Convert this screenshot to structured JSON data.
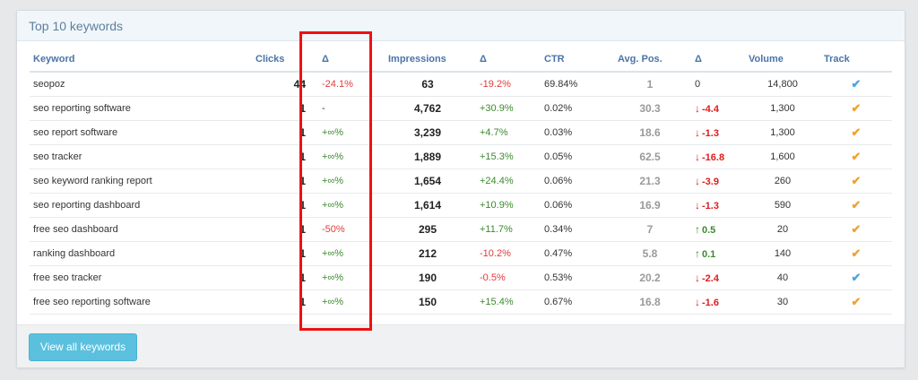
{
  "title": "Top 10 keywords",
  "columns": {
    "keyword": "Keyword",
    "clicks": "Clicks",
    "clicks_delta": "Δ",
    "impressions": "Impressions",
    "impressions_delta": "Δ",
    "ctr": "CTR",
    "avg_pos": "Avg. Pos.",
    "pos_delta": "Δ",
    "volume": "Volume",
    "track": "Track"
  },
  "rows": [
    {
      "keyword": "seopoz",
      "clicks": "44",
      "clicks_delta": "-24.1%",
      "clicks_delta_dir": "down",
      "impressions": "63",
      "impressions_delta": "-19.2%",
      "impressions_delta_dir": "down",
      "ctr": "69.84%",
      "avg_pos": "1",
      "pos_delta": "0",
      "pos_dir": "neutral",
      "pos_arrow": "",
      "volume": "14,800",
      "tracked": "blue"
    },
    {
      "keyword": "seo reporting software",
      "clicks": "1",
      "clicks_delta": "-",
      "clicks_delta_dir": "neutral",
      "impressions": "4,762",
      "impressions_delta": "+30.9%",
      "impressions_delta_dir": "up",
      "ctr": "0.02%",
      "avg_pos": "30.3",
      "pos_delta": "-4.4",
      "pos_dir": "down",
      "pos_arrow": "↓",
      "volume": "1,300",
      "tracked": "orange"
    },
    {
      "keyword": "seo report software",
      "clicks": "1",
      "clicks_delta": "+∞%",
      "clicks_delta_dir": "up",
      "impressions": "3,239",
      "impressions_delta": "+4.7%",
      "impressions_delta_dir": "up",
      "ctr": "0.03%",
      "avg_pos": "18.6",
      "pos_delta": "-1.3",
      "pos_dir": "down",
      "pos_arrow": "↓",
      "volume": "1,300",
      "tracked": "orange"
    },
    {
      "keyword": "seo tracker",
      "clicks": "1",
      "clicks_delta": "+∞%",
      "clicks_delta_dir": "up",
      "impressions": "1,889",
      "impressions_delta": "+15.3%",
      "impressions_delta_dir": "up",
      "ctr": "0.05%",
      "avg_pos": "62.5",
      "pos_delta": "-16.8",
      "pos_dir": "down",
      "pos_arrow": "↓",
      "volume": "1,600",
      "tracked": "orange"
    },
    {
      "keyword": "seo keyword ranking report",
      "clicks": "1",
      "clicks_delta": "+∞%",
      "clicks_delta_dir": "up",
      "impressions": "1,654",
      "impressions_delta": "+24.4%",
      "impressions_delta_dir": "up",
      "ctr": "0.06%",
      "avg_pos": "21.3",
      "pos_delta": "-3.9",
      "pos_dir": "down",
      "pos_arrow": "↓",
      "volume": "260",
      "tracked": "orange"
    },
    {
      "keyword": "seo reporting dashboard",
      "clicks": "1",
      "clicks_delta": "+∞%",
      "clicks_delta_dir": "up",
      "impressions": "1,614",
      "impressions_delta": "+10.9%",
      "impressions_delta_dir": "up",
      "ctr": "0.06%",
      "avg_pos": "16.9",
      "pos_delta": "-1.3",
      "pos_dir": "down",
      "pos_arrow": "↓",
      "volume": "590",
      "tracked": "orange"
    },
    {
      "keyword": "free seo dashboard",
      "clicks": "1",
      "clicks_delta": "-50%",
      "clicks_delta_dir": "down",
      "impressions": "295",
      "impressions_delta": "+11.7%",
      "impressions_delta_dir": "up",
      "ctr": "0.34%",
      "avg_pos": "7",
      "pos_delta": "0.5",
      "pos_dir": "up",
      "pos_arrow": "↑",
      "volume": "20",
      "tracked": "orange"
    },
    {
      "keyword": "ranking dashboard",
      "clicks": "1",
      "clicks_delta": "+∞%",
      "clicks_delta_dir": "up",
      "impressions": "212",
      "impressions_delta": "-10.2%",
      "impressions_delta_dir": "down",
      "ctr": "0.47%",
      "avg_pos": "5.8",
      "pos_delta": "0.1",
      "pos_dir": "up",
      "pos_arrow": "↑",
      "volume": "140",
      "tracked": "orange"
    },
    {
      "keyword": "free seo tracker",
      "clicks": "1",
      "clicks_delta": "+∞%",
      "clicks_delta_dir": "up",
      "impressions": "190",
      "impressions_delta": "-0.5%",
      "impressions_delta_dir": "down",
      "ctr": "0.53%",
      "avg_pos": "20.2",
      "pos_delta": "-2.4",
      "pos_dir": "down",
      "pos_arrow": "↓",
      "volume": "40",
      "tracked": "blue"
    },
    {
      "keyword": "free seo reporting software",
      "clicks": "1",
      "clicks_delta": "+∞%",
      "clicks_delta_dir": "up",
      "impressions": "150",
      "impressions_delta": "+15.4%",
      "impressions_delta_dir": "up",
      "ctr": "0.67%",
      "avg_pos": "16.8",
      "pos_delta": "-1.6",
      "pos_dir": "down",
      "pos_arrow": "↓",
      "volume": "30",
      "tracked": "orange"
    }
  ],
  "track_icon": "check-icon",
  "colors": {
    "positive": "#3c8a2e",
    "negative": "#e23a3a",
    "position_negative": "#e01b1b",
    "check_blue": "#4aa6e0",
    "check_orange": "#f0a132",
    "highlight": "#ee1111",
    "button": "#5bc0de",
    "header_text": "#4a74a8"
  },
  "footer": {
    "button_label": "View all keywords"
  }
}
